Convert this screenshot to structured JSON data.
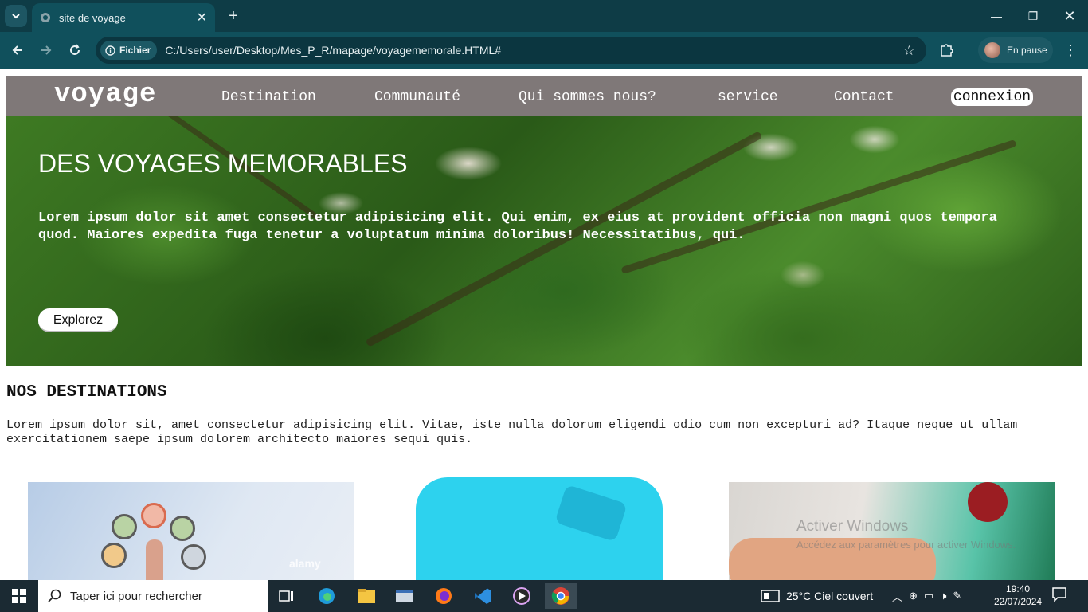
{
  "browser": {
    "tab_title": "site de voyage",
    "address_chip": "Fichier",
    "url": "C:/Users/user/Desktop/Mes_P_R/mapage/voyagememorale.HTML#",
    "profile_label": "En pause"
  },
  "site": {
    "logo": "voyage",
    "nav": [
      "Destination",
      "Communauté",
      "Qui sommes nous?",
      "service",
      "Contact"
    ],
    "login": "connexion"
  },
  "hero": {
    "title": "DES VOYAGES MEMORABLES",
    "text": "Lorem ipsum dolor sit amet consectetur adipisicing elit. Qui enim, ex eius at provident officia non magni quos tempora quod. Maiores expedita fuga tenetur a voluptatum minima doloribus! Necessitatibus, qui.",
    "button": "Explorez"
  },
  "destinations": {
    "title": "NOS DESTINATIONS",
    "text": "Lorem ipsum dolor sit, amet consectetur adipisicing elit. Vitae, iste nulla dolorum eligendi odio cum non excepturi ad? Itaque neque ut ullam exercitationem saepe ipsum dolorem architecto maiores sequi quis.",
    "card1_watermark": "alamy"
  },
  "windows_watermark": {
    "line1": "Activer Windows",
    "line2": "Accédez aux paramètres pour activer Windows."
  },
  "taskbar": {
    "search_placeholder": "Taper ici pour rechercher",
    "weather": "25°C  Ciel couvert",
    "time": "19:40",
    "date": "22/07/2024"
  }
}
